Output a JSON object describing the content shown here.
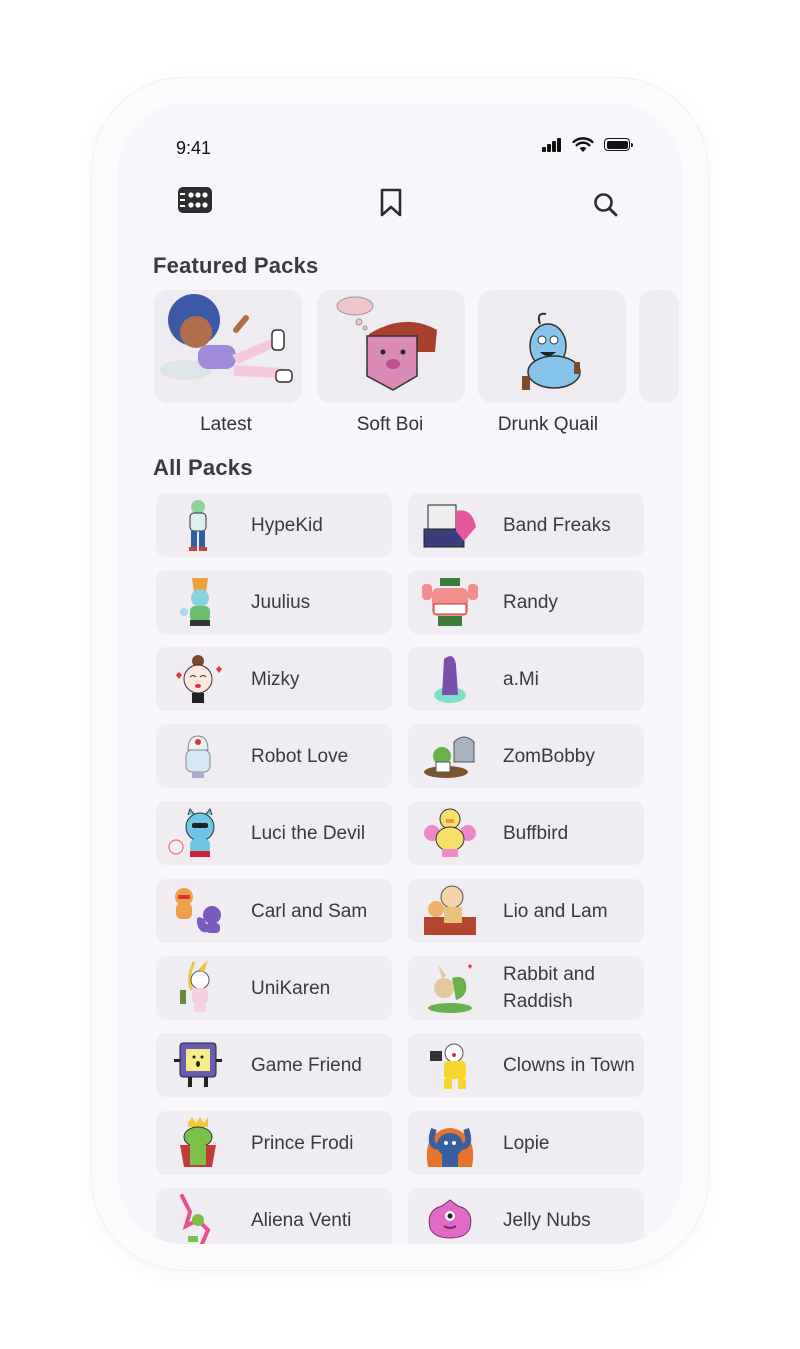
{
  "status_bar": {
    "time": "9:41"
  },
  "nav": {
    "menu_icon": "grid-menu-icon",
    "bookmark_icon": "bookmark-icon",
    "search_icon": "search-icon"
  },
  "featured": {
    "title": "Featured Packs",
    "items": [
      {
        "label": "Latest"
      },
      {
        "label": "Soft Boi"
      },
      {
        "label": "Drunk Quail"
      }
    ]
  },
  "all_packs": {
    "title": "All Packs",
    "items": [
      {
        "name": "HypeKid"
      },
      {
        "name": "Band Freaks"
      },
      {
        "name": "Juulius"
      },
      {
        "name": "Randy"
      },
      {
        "name": "Mizky"
      },
      {
        "name": "a.Mi"
      },
      {
        "name": "Robot Love"
      },
      {
        "name": "ZomBobby"
      },
      {
        "name": "Luci the Devil"
      },
      {
        "name": "Buffbird"
      },
      {
        "name": "Carl and Sam"
      },
      {
        "name": "Lio and Lam"
      },
      {
        "name": "UniKaren"
      },
      {
        "name": "Rabbit and Raddish"
      },
      {
        "name": "Game Friend"
      },
      {
        "name": "Clowns in Town"
      },
      {
        "name": "Prince Frodi"
      },
      {
        "name": "Lopie"
      },
      {
        "name": "Aliena Venti"
      },
      {
        "name": "Jelly Nubs"
      }
    ]
  }
}
